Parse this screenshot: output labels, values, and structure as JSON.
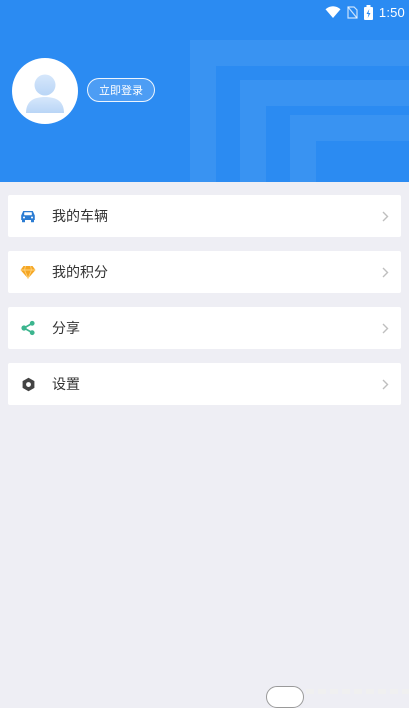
{
  "status_bar": {
    "time": "1:50",
    "icons": [
      "wifi-icon",
      "no-sim-icon",
      "battery-charging-icon"
    ]
  },
  "header": {
    "login_button": "立即登录",
    "avatar_icon": "user-avatar-icon"
  },
  "menu": {
    "items": [
      {
        "label": "我的车辆",
        "icon": "car-icon",
        "icon_color": "#2B7CD3"
      },
      {
        "label": "我的积分",
        "icon": "diamond-icon",
        "icon_color": "#F5A623"
      },
      {
        "label": "分享",
        "icon": "share-icon",
        "icon_color": "#3CB58E"
      },
      {
        "label": "设置",
        "icon": "settings-hex-icon",
        "icon_color": "#444444"
      }
    ],
    "chevron_icon": "chevron-right-icon"
  },
  "colors": {
    "header_bg": "#2B8BF2",
    "page_bg": "#EEEEF4",
    "card_bg": "#FFFFFF",
    "text": "#333333"
  }
}
